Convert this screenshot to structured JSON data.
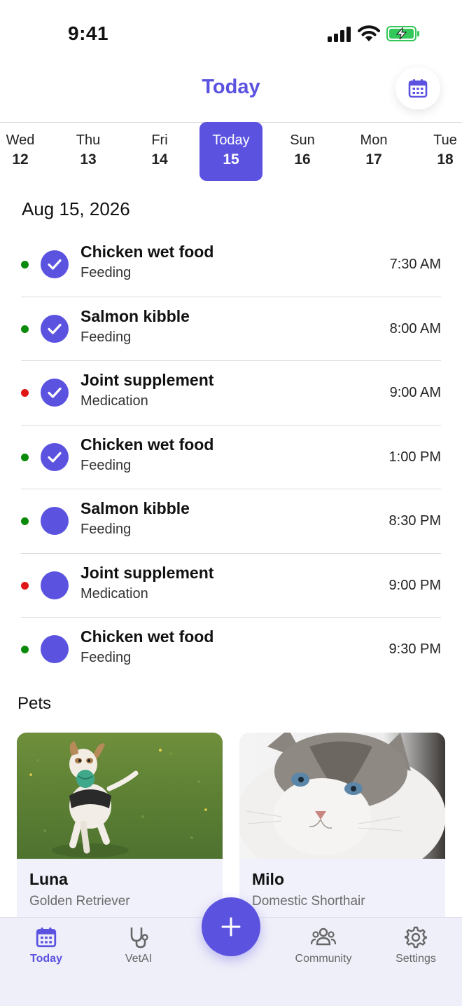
{
  "status_bar": {
    "time": "9:41"
  },
  "header": {
    "title": "Today"
  },
  "date_strip": [
    {
      "dow": "Wed",
      "day": "12"
    },
    {
      "dow": "Thu",
      "day": "13"
    },
    {
      "dow": "Fri",
      "day": "14"
    },
    {
      "dow": "Today",
      "day": "15",
      "selected": true
    },
    {
      "dow": "Sun",
      "day": "16"
    },
    {
      "dow": "Mon",
      "day": "17"
    },
    {
      "dow": "Tue",
      "day": "18"
    }
  ],
  "date_heading": "Aug 15, 2026",
  "tasks": [
    {
      "title": "Chicken wet food",
      "category": "Feeding",
      "time": "7:30 AM",
      "done": true,
      "dot_color": "#0a8a0a"
    },
    {
      "title": "Salmon kibble",
      "category": "Feeding",
      "time": "8:00 AM",
      "done": true,
      "dot_color": "#0a8a0a"
    },
    {
      "title": "Joint supplement",
      "category": "Medication",
      "time": "9:00 AM",
      "done": true,
      "dot_color": "#e01515"
    },
    {
      "title": "Chicken wet food",
      "category": "Feeding",
      "time": "1:00 PM",
      "done": true,
      "dot_color": "#0a8a0a"
    },
    {
      "title": "Salmon kibble",
      "category": "Feeding",
      "time": "8:30 PM",
      "done": false,
      "dot_color": "#0a8a0a"
    },
    {
      "title": "Joint supplement",
      "category": "Medication",
      "time": "9:00 PM",
      "done": false,
      "dot_color": "#e01515"
    },
    {
      "title": "Chicken wet food",
      "category": "Feeding",
      "time": "9:30 PM",
      "done": false,
      "dot_color": "#0a8a0a"
    }
  ],
  "pets_heading": "Pets",
  "pets": [
    {
      "name": "Luna",
      "breed": "Golden Retriever"
    },
    {
      "name": "Milo",
      "breed": "Domestic Shorthair"
    }
  ],
  "tab_bar": {
    "today": "Today",
    "vetai": "VetAI",
    "community": "Community",
    "settings": "Settings"
  },
  "colors": {
    "accent": "#5b53e0",
    "feeding_dot": "#0a8a0a",
    "medication_dot": "#e01515"
  }
}
